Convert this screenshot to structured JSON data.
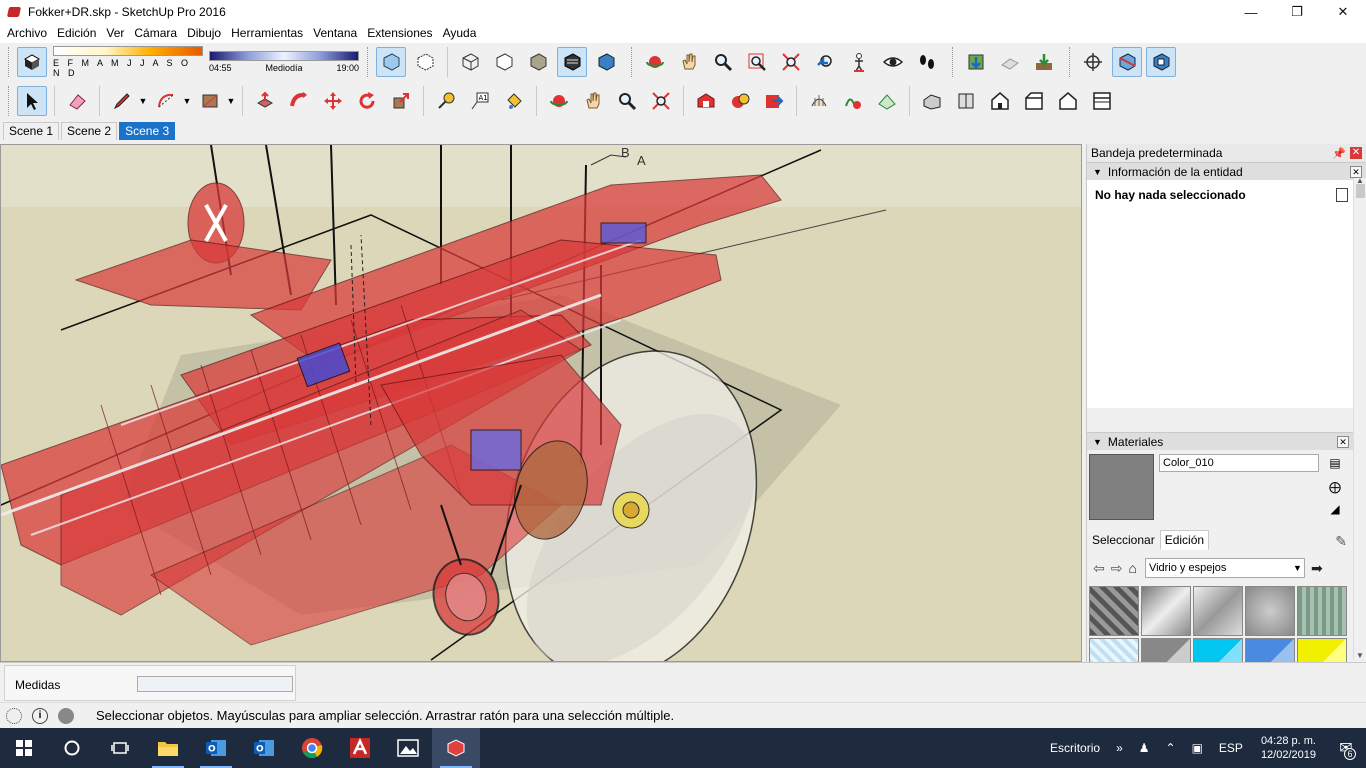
{
  "window": {
    "title": "Fokker+DR.skp - SketchUp Pro 2016"
  },
  "menu": [
    "Archivo",
    "Edición",
    "Ver",
    "Cámara",
    "Dibujo",
    "Herramientas",
    "Ventana",
    "Extensiones",
    "Ayuda"
  ],
  "shadows": {
    "months": "E F M A M J J A S O N D",
    "time_start": "04:55",
    "time_mid": "Mediodía",
    "time_end": "19:00"
  },
  "scenes": [
    {
      "label": "Scene 1",
      "active": false
    },
    {
      "label": "Scene 2",
      "active": false
    },
    {
      "label": "Scene 3",
      "active": true
    }
  ],
  "viewport": {
    "label_b": "B",
    "label_a": "A"
  },
  "tray": {
    "title": "Bandeja predeterminada",
    "entity": {
      "header": "Información de la entidad",
      "status": "No hay nada seleccionado"
    },
    "materials": {
      "header": "Materiales",
      "current_name": "Color_010",
      "tabs": [
        "Seleccionar",
        "Edición"
      ],
      "library": "Vidrio y espejos"
    }
  },
  "measurements": {
    "label": "Medidas"
  },
  "status": {
    "hint": "Seleccionar objetos. Mayúsculas para ampliar selección. Arrastrar ratón para una selección múltiple."
  },
  "taskbar": {
    "desktop": "Escritorio",
    "lang": "ESP",
    "time": "04:28 p. m.",
    "date": "12/02/2019",
    "notifications": "6"
  },
  "colors": {
    "accent": "#1a73c8",
    "plane_red": "#d93a3a",
    "ground": "#dcd7b8",
    "taskbar": "#1e2a3e"
  }
}
